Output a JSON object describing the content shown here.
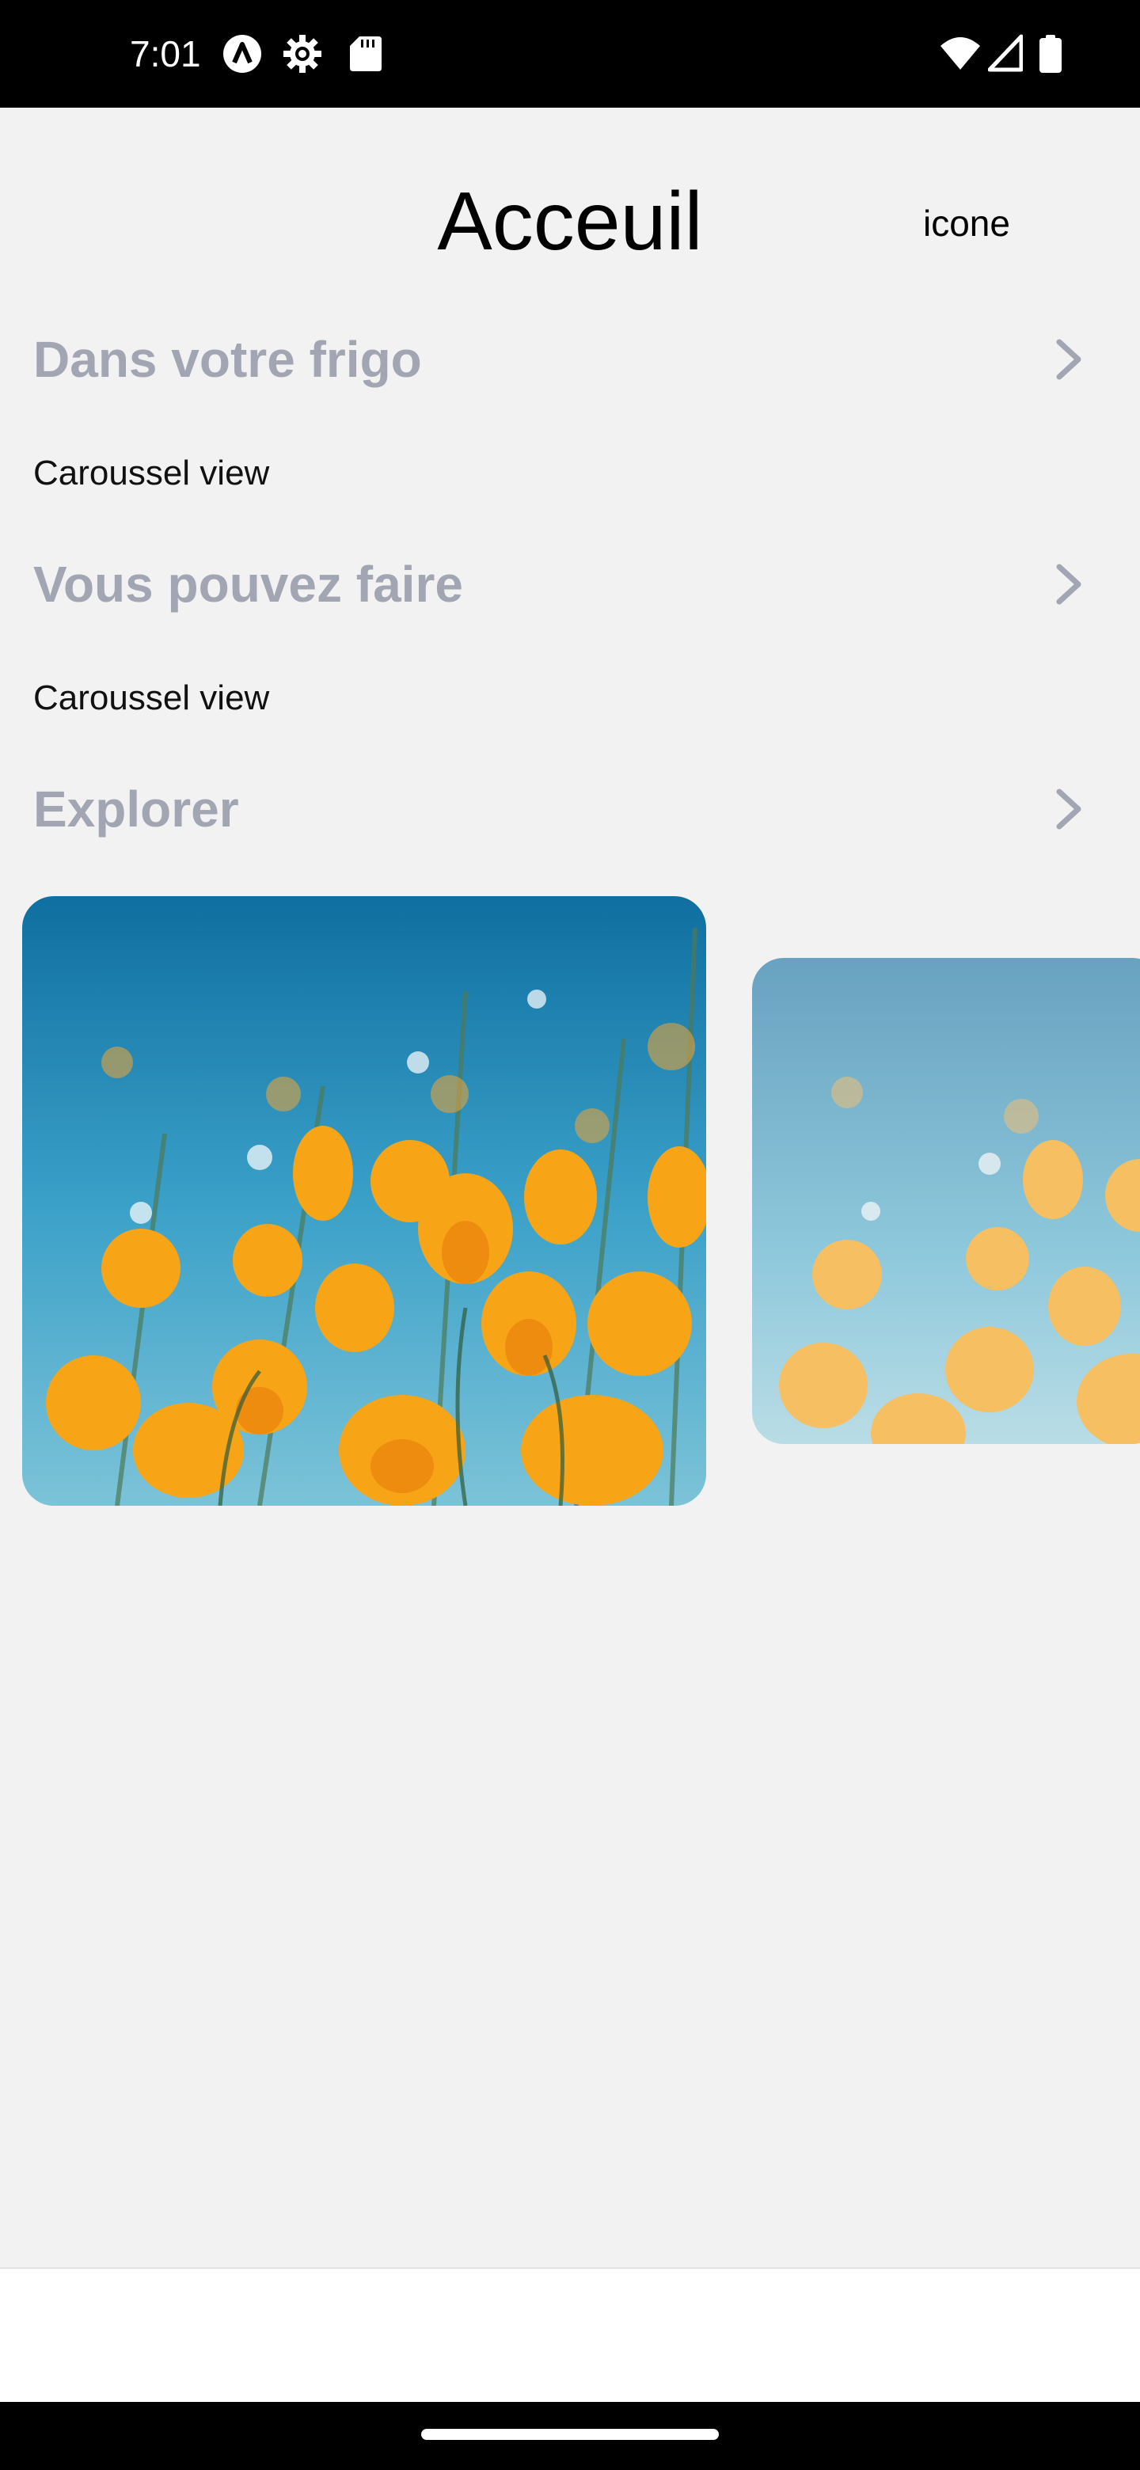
{
  "status_bar": {
    "time": "7:01",
    "left_icons": [
      "app-a-icon",
      "settings-icon",
      "sd-card-icon"
    ],
    "right_icons": [
      "wifi-icon",
      "signal-icon",
      "battery-icon"
    ]
  },
  "header": {
    "title": "Acceuil",
    "icon_text": "icone"
  },
  "sections": [
    {
      "title": "Dans votre frigo",
      "content": "Caroussel view"
    },
    {
      "title": "Vous pouvez faire",
      "content": "Caroussel view"
    },
    {
      "title": "Explorer"
    }
  ],
  "colors": {
    "section_title": "#a1a6b2",
    "background": "#f2f2f2"
  }
}
